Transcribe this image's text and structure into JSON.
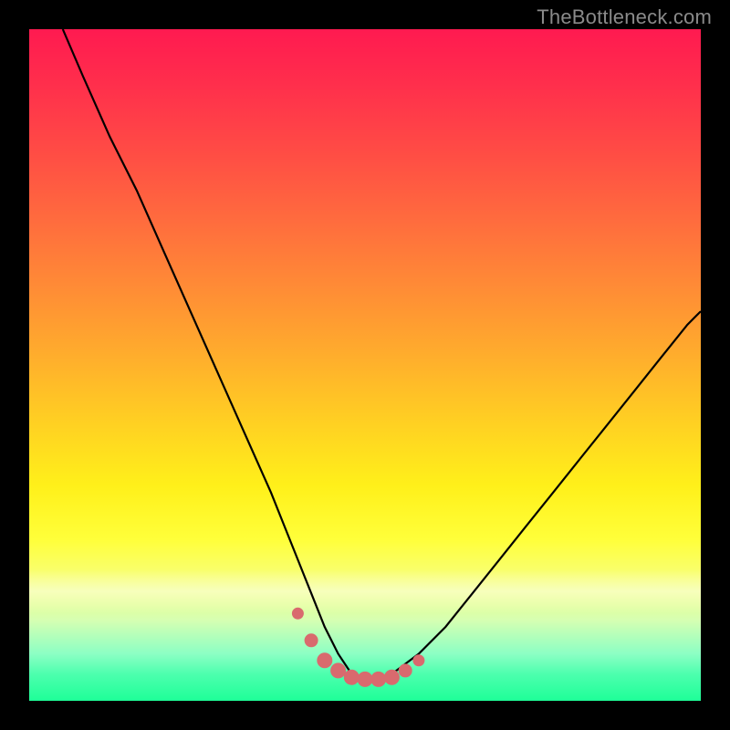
{
  "watermark": "TheBottleneck.com",
  "colors": {
    "frame_background": "#000000",
    "curve_stroke": "#000000",
    "marker_fill": "#d96a6e",
    "marker_stroke": "#d96a6e"
  },
  "chart_data": {
    "type": "line",
    "title": "",
    "xlabel": "",
    "ylabel": "",
    "xlim": [
      0,
      100
    ],
    "ylim": [
      0,
      100
    ],
    "grid": false,
    "legend": false,
    "series": [
      {
        "name": "bottleneck-curve",
        "x": [
          5,
          8,
          12,
          16,
          20,
          24,
          28,
          32,
          36,
          38,
          40,
          42,
          44,
          46,
          48,
          50,
          52,
          54,
          58,
          62,
          66,
          70,
          74,
          78,
          82,
          86,
          90,
          94,
          98,
          100
        ],
        "y": [
          100,
          93,
          84,
          76,
          67,
          58,
          49,
          40,
          31,
          26,
          21,
          16,
          11,
          7,
          4,
          3,
          3,
          4,
          7,
          11,
          16,
          21,
          26,
          31,
          36,
          41,
          46,
          51,
          56,
          58
        ]
      }
    ],
    "markers": {
      "name": "highlight-dots",
      "x": [
        40,
        42,
        44,
        46,
        48,
        50,
        52,
        54,
        56,
        58
      ],
      "y": [
        13,
        9,
        6,
        4.5,
        3.5,
        3.2,
        3.2,
        3.5,
        4.5,
        6
      ],
      "r": [
        6,
        7,
        8,
        8,
        8,
        8,
        8,
        8,
        7,
        6
      ]
    }
  }
}
